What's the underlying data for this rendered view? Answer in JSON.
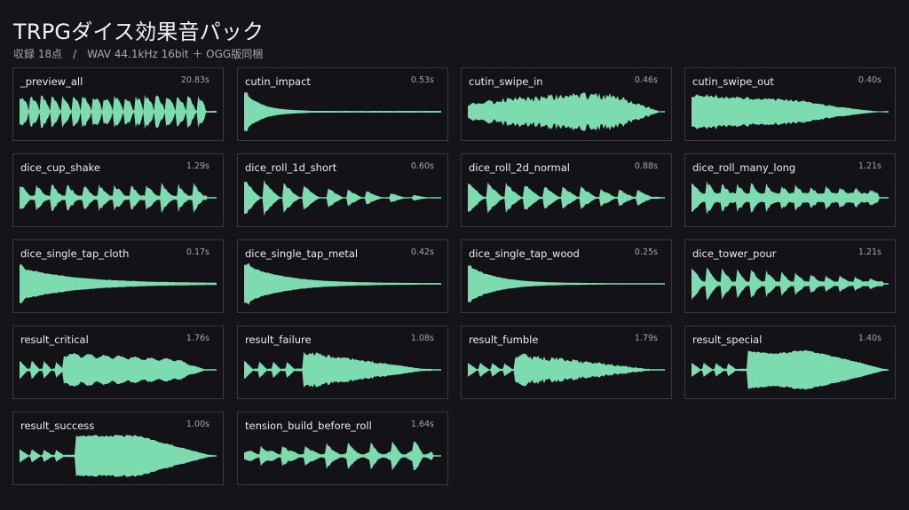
{
  "header": {
    "title": "TRPGダイス効果音パック",
    "subtitle": "収録 18点　/　WAV 44.1kHz 16bit ＋ OGG版同梱"
  },
  "colors": {
    "wave": "#7ddbb0",
    "background": "#151519",
    "border": "#3a3a40"
  },
  "cards": [
    {
      "name": "_preview_all",
      "duration": "20.83s",
      "wave": "bursts_long"
    },
    {
      "name": "cutin_impact",
      "duration": "0.53s",
      "wave": "impact"
    },
    {
      "name": "cutin_swipe_in",
      "duration": "0.46s",
      "wave": "swipe_in"
    },
    {
      "name": "cutin_swipe_out",
      "duration": "0.40s",
      "wave": "swipe_out"
    },
    {
      "name": "dice_cup_shake",
      "duration": "1.29s",
      "wave": "rattle"
    },
    {
      "name": "dice_roll_1d_short",
      "duration": "0.60s",
      "wave": "roll_short"
    },
    {
      "name": "dice_roll_2d_normal",
      "duration": "0.88s",
      "wave": "roll_normal"
    },
    {
      "name": "dice_roll_many_long",
      "duration": "1.21s",
      "wave": "roll_many"
    },
    {
      "name": "dice_single_tap_cloth",
      "duration": "0.17s",
      "wave": "tap_cloth"
    },
    {
      "name": "dice_single_tap_metal",
      "duration": "0.42s",
      "wave": "tap_metal"
    },
    {
      "name": "dice_single_tap_wood",
      "duration": "0.25s",
      "wave": "tap_wood"
    },
    {
      "name": "dice_tower_pour",
      "duration": "1.21s",
      "wave": "tower"
    },
    {
      "name": "result_critical",
      "duration": "1.76s",
      "wave": "critical"
    },
    {
      "name": "result_failure",
      "duration": "1.08s",
      "wave": "failure"
    },
    {
      "name": "result_fumble",
      "duration": "1.79s",
      "wave": "fumble"
    },
    {
      "name": "result_special",
      "duration": "1.40s",
      "wave": "special"
    },
    {
      "name": "result_success",
      "duration": "1.00s",
      "wave": "success"
    },
    {
      "name": "tension_build_before_roll",
      "duration": "1.64s",
      "wave": "tension"
    }
  ]
}
